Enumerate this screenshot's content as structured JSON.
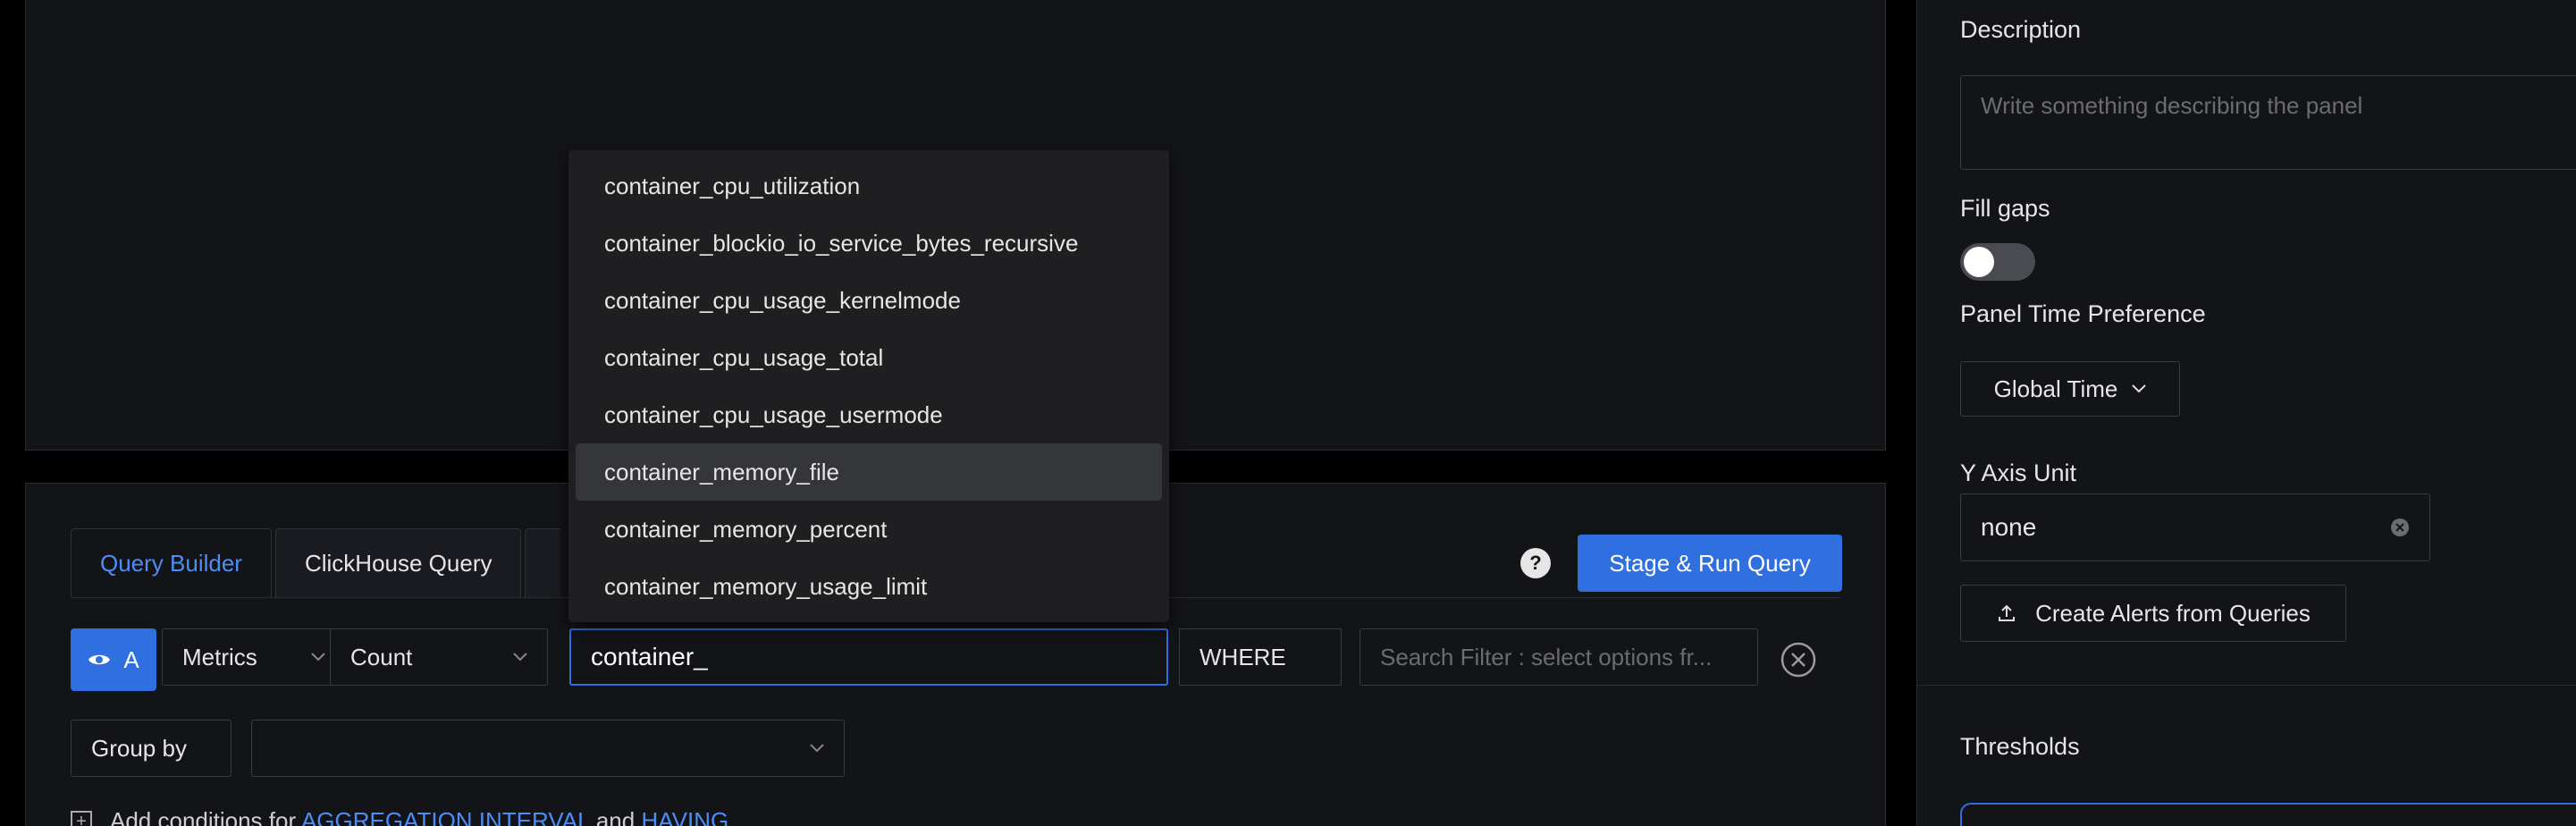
{
  "query_panel": {
    "tabs": [
      {
        "label": "Query Builder"
      },
      {
        "label": "ClickHouse Query"
      }
    ],
    "help_glyph": "?",
    "run_button": "Stage & Run Query",
    "query_letter": "A",
    "data_source": "Metrics",
    "aggregate": "Count",
    "metric_input_value": "container_",
    "where_label": "WHERE",
    "search_filter_placeholder": "Search Filter : select options fr...",
    "group_by_label": "Group by",
    "add_conditions": {
      "prefix": "Add conditions for",
      "link1": "AGGREGATION INTERVAL",
      "middle": "and",
      "link2": "HAVING"
    }
  },
  "dropdown": {
    "items": [
      {
        "label": "container_cpu_utilization"
      },
      {
        "label": "container_blockio_io_service_bytes_recursive"
      },
      {
        "label": "container_cpu_usage_kernelmode"
      },
      {
        "label": "container_cpu_usage_total"
      },
      {
        "label": "container_cpu_usage_usermode"
      },
      {
        "label": "container_memory_file",
        "active": true
      },
      {
        "label": "container_memory_percent"
      },
      {
        "label": "container_memory_usage_limit"
      }
    ]
  },
  "sidebar": {
    "description_label": "Description",
    "description_placeholder": "Write something describing the  panel",
    "fill_gaps_label": "Fill gaps",
    "fill_gaps_on": false,
    "time_pref_label": "Panel Time Preference",
    "time_pref_value": "Global Time",
    "y_axis_label": "Y Axis Unit",
    "y_axis_value": "none",
    "alerts_button": "Create Alerts from Queries",
    "thresholds_label": "Thresholds"
  },
  "colors": {
    "accent": "#2f6fe0",
    "link": "#4e8df5",
    "background": "#131418"
  }
}
